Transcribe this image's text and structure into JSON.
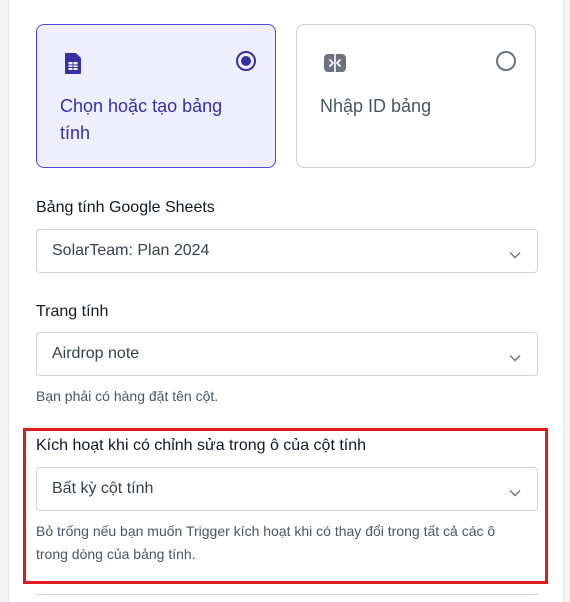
{
  "source_mode": {
    "select_option": {
      "label": "Chọn hoặc tạo bảng tính",
      "icon": "spreadsheet-icon",
      "selected": true
    },
    "id_option": {
      "label": "Nhập ID bảng",
      "icon": "id-input-icon",
      "selected": false
    }
  },
  "spreadsheet": {
    "label": "Bảng tính Google Sheets",
    "value": "SolarTeam: Plan 2024"
  },
  "worksheet": {
    "label": "Trang tính",
    "value": "Airdrop note",
    "help": "Bạn phải có hàng đặt tên cột."
  },
  "trigger_column": {
    "label": "Kích hoạt khi có chỉnh sửa trong ô của cột tính",
    "value": "Bất kỳ cột tính",
    "help": "Bỏ trống nếu bạn muốn Trigger kích hoạt khi có thay đổi trong tất cả các ô trong dòng của bảng tính."
  },
  "colors": {
    "accent": "#3730a3",
    "selected_card_bg": "#eeeefe",
    "highlight_border": "#e01b1b"
  }
}
